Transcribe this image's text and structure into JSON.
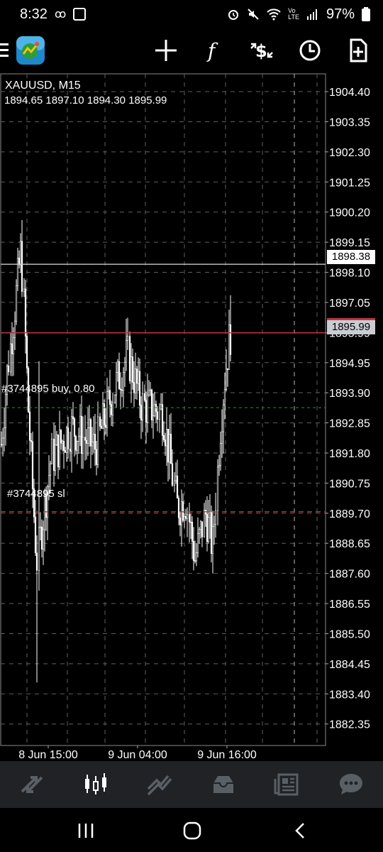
{
  "status": {
    "time": "8:32",
    "battery": "97%"
  },
  "chart": {
    "symbol_tf": "XAUUSD, M15",
    "ohlc": "1894.65 1897.10 1894.30 1895.99",
    "ask_label": "1898.38",
    "bid_label": "1895.99",
    "order_label": "#3744895 buy, 0.80",
    "sl_label": "#3744895 sl",
    "order_price": 1893.38,
    "sl_price": 1889.75,
    "ask_price": 1898.38,
    "bid_price": 1895.99
  },
  "chart_data": {
    "type": "candlestick",
    "title": "XAUUSD, M15",
    "ylim": [
      1881.6,
      1905.02
    ],
    "y_ticks": [
      "1904.40",
      "1903.35",
      "1902.30",
      "1901.25",
      "1900.20",
      "1899.15",
      "1898.10",
      "1897.05",
      "1895.99",
      "1894.95",
      "1893.90",
      "1892.85",
      "1891.80",
      "1890.75",
      "1889.70",
      "1888.65",
      "1887.60",
      "1886.55",
      "1885.50",
      "1884.45",
      "1883.40",
      "1882.35"
    ],
    "x_ticks": [
      "8 Jun 15:00",
      "9 Jun 04:00",
      "9 Jun 16:00"
    ],
    "grid": true
  },
  "colors": {
    "background": "#000000",
    "grid": "#5f5f5f",
    "candle": "#ffffff",
    "ask_line": "#c8c8c8",
    "bid_line": "#c0353d",
    "order_line": "#2e7d32",
    "sl_line": "#c0353d",
    "nav_bg": "#202226",
    "nav_icon": "#5a5f66",
    "nav_active": "#ffffff"
  },
  "toolbar": {
    "icons": [
      "menu-icon",
      "metatrader-logo",
      "crosshair-icon",
      "indicator-icon",
      "trade-icon",
      "clock-icon",
      "new-order-icon"
    ]
  },
  "bottom_nav": {
    "items": [
      "quotes-icon",
      "chart-icon",
      "trade-icon",
      "history-icon",
      "news-icon",
      "chat-icon"
    ],
    "active": "chart-icon"
  }
}
